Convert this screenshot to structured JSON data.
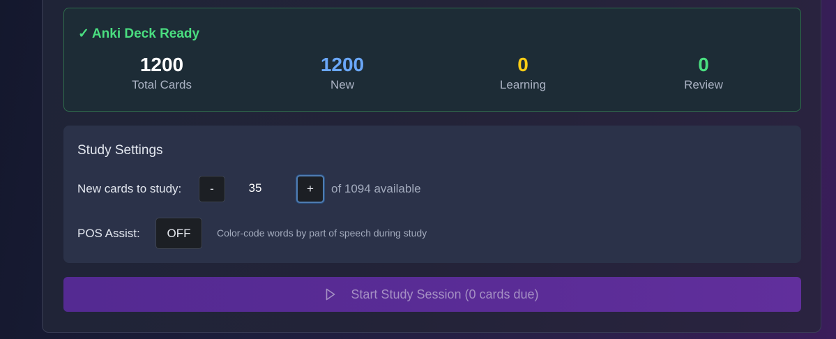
{
  "deck": {
    "check_glyph": "✓",
    "title": "Anki Deck Ready",
    "stats": [
      {
        "value": "1200",
        "label": "Total Cards",
        "color": "#ffffff"
      },
      {
        "value": "1200",
        "label": "New",
        "color": "#6aa7f8"
      },
      {
        "value": "0",
        "label": "Learning",
        "color": "#facc15"
      },
      {
        "value": "0",
        "label": "Review",
        "color": "#4ade80"
      }
    ],
    "accent": "#4ade80"
  },
  "settings": {
    "title": "Study Settings",
    "new_cards": {
      "label": "New cards to study:",
      "minus_label": "-",
      "value": "35",
      "plus_label": "+",
      "available_text": "of 1094 available"
    },
    "pos_assist": {
      "label": "POS Assist:",
      "toggle_label": "OFF",
      "description": "Color-code words by part of speech during study"
    }
  },
  "start": {
    "icon": "play-icon",
    "label": "Start Study Session (0 cards due)",
    "color": "#5a2c96"
  }
}
